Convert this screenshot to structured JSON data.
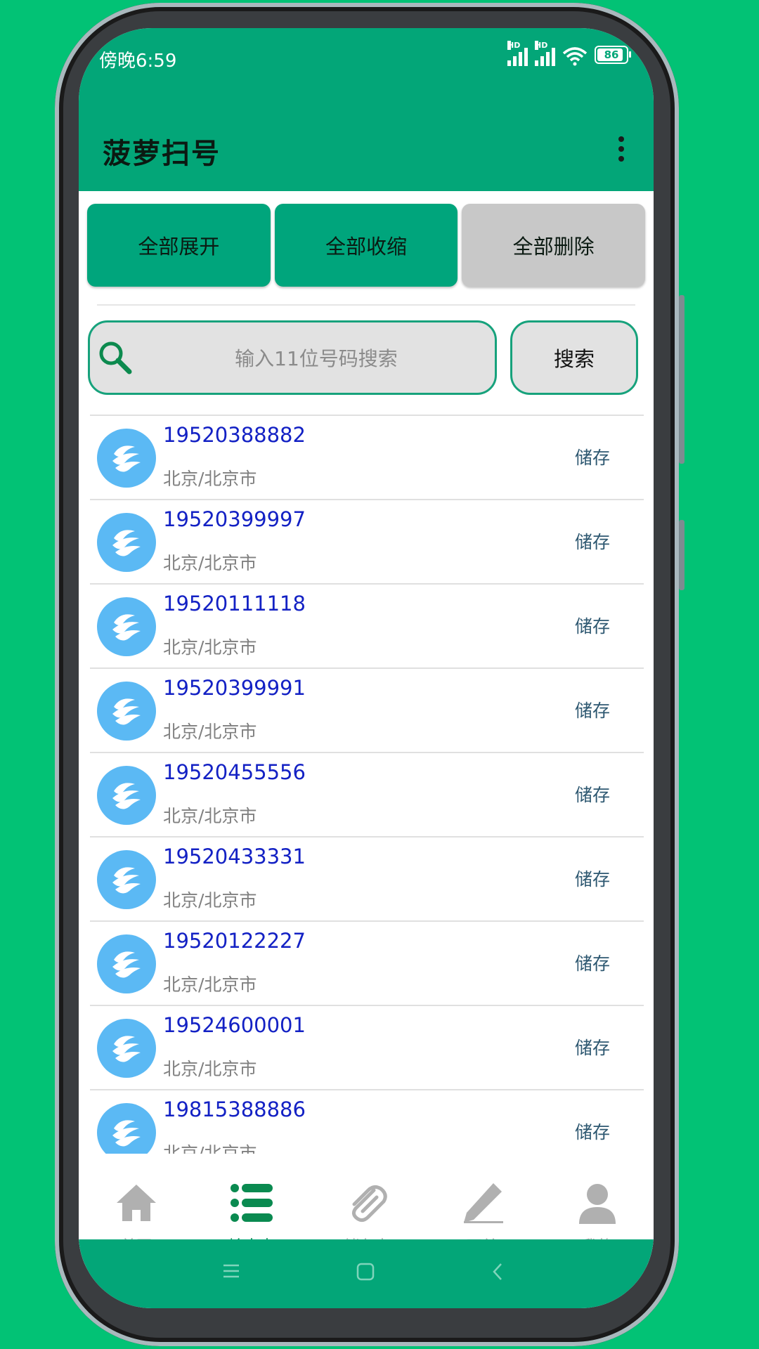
{
  "status": {
    "time": "傍晚6:59",
    "battery": "86",
    "hd_label": "HD"
  },
  "app": {
    "title": "菠萝扫号"
  },
  "actions": {
    "expand_all": "全部展开",
    "collapse_all": "全部收缩",
    "delete_all": "全部删除"
  },
  "search": {
    "placeholder": "输入11位号码搜索",
    "button": "搜索"
  },
  "list": [
    {
      "number": "19520388882",
      "region": "北京/北京市",
      "action": "储存"
    },
    {
      "number": "19520399997",
      "region": "北京/北京市",
      "action": "储存"
    },
    {
      "number": "19520111118",
      "region": "北京/北京市",
      "action": "储存"
    },
    {
      "number": "19520399991",
      "region": "北京/北京市",
      "action": "储存"
    },
    {
      "number": "19520455556",
      "region": "北京/北京市",
      "action": "储存"
    },
    {
      "number": "19520433331",
      "region": "北京/北京市",
      "action": "储存"
    },
    {
      "number": "19520122227",
      "region": "北京/北京市",
      "action": "储存"
    },
    {
      "number": "19524600001",
      "region": "北京/北京市",
      "action": "储存"
    },
    {
      "number": "19815388886",
      "region": "北京/北京市",
      "action": "储存"
    }
  ],
  "nav": [
    {
      "label": "首页",
      "icon": "home-icon"
    },
    {
      "label": "输出表",
      "icon": "list-icon"
    },
    {
      "label": "储存表",
      "icon": "paperclip-icon"
    },
    {
      "label": "下单",
      "icon": "pencil-icon"
    },
    {
      "label": "我的",
      "icon": "person-icon"
    }
  ],
  "colors": {
    "primary": "#03a678",
    "background": "#02c275",
    "number_text": "#1321c4",
    "active_nav": "#0a8a50"
  }
}
